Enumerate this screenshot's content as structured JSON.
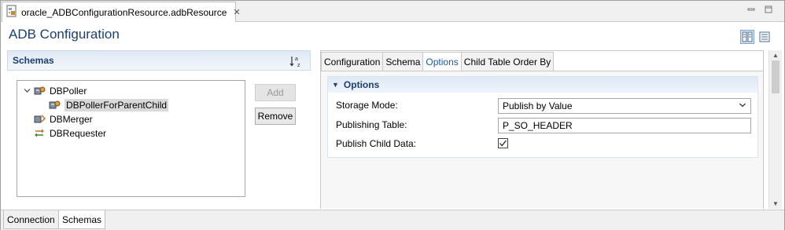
{
  "editor_tab": {
    "title": "oracle_ADBConfigurationResource.adbResource",
    "close": "✕"
  },
  "page_title": "ADB Configuration",
  "schemas": {
    "header": "Schemas",
    "tree": [
      {
        "label": "DBPoller",
        "icon": "db-poller-icon",
        "expanded": true,
        "level": 0
      },
      {
        "label": "DBPollerForParentChild",
        "icon": "db-poller-icon",
        "selected": true,
        "level": 1
      },
      {
        "label": "DBMerger",
        "icon": "db-merger-icon",
        "level": 0
      },
      {
        "label": "DBRequester",
        "icon": "db-requester-icon",
        "level": 0
      }
    ],
    "add_label": "Add",
    "remove_label": "Remove"
  },
  "tabs": [
    "Configuration",
    "Schema",
    "Options",
    "Child Table Order By"
  ],
  "active_tab": "Options",
  "options": {
    "header": "Options",
    "storage_mode_label": "Storage Mode:",
    "storage_mode_value": "Publish by Value",
    "publishing_table_label": "Publishing Table:",
    "publishing_table_value": "P_SO_HEADER",
    "publish_child_label": "Publish Child Data:",
    "publish_child_checked": true
  },
  "bottom_tabs": [
    "Connection",
    "Schemas"
  ],
  "colors": {
    "accent": "#1d3f6b",
    "active_tab_text": "#1c5aa6",
    "section_header": "#dfe9f5"
  }
}
